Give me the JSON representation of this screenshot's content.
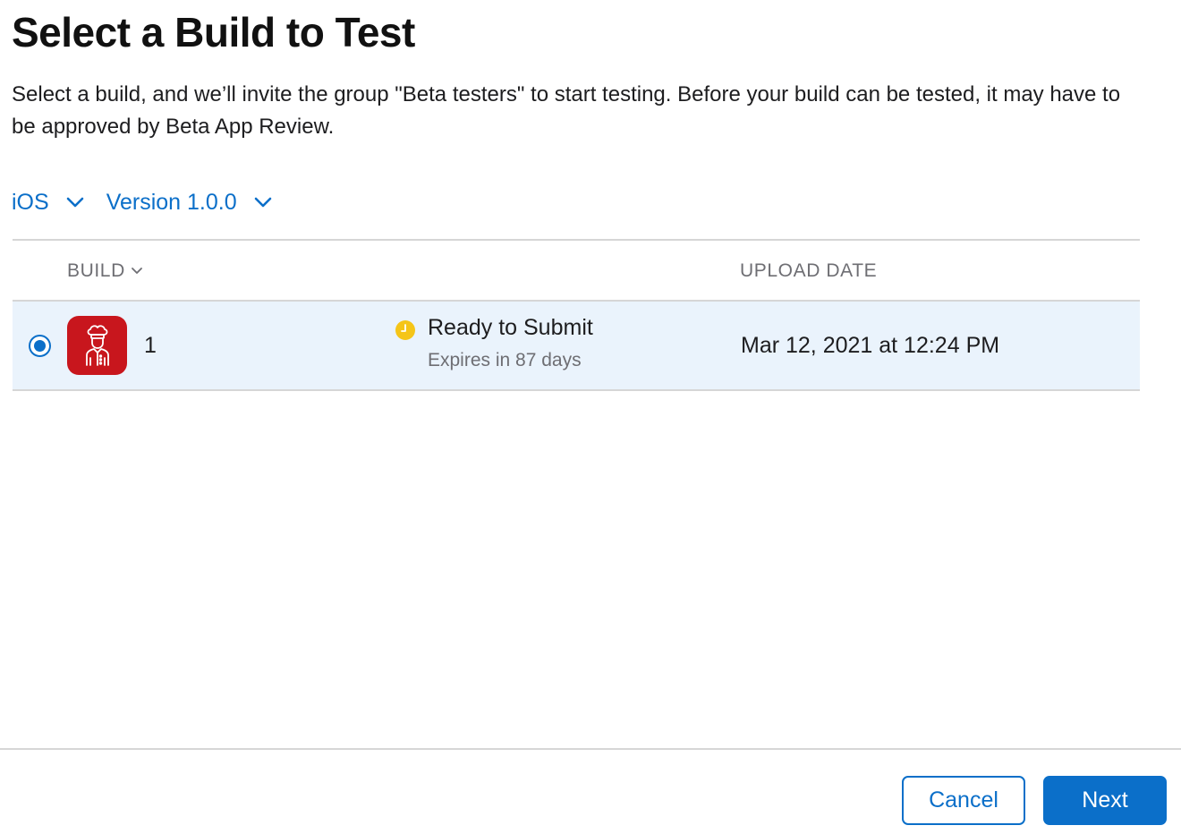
{
  "dialog": {
    "title": "Select a Build to Test",
    "description": "Select a build, and we’ll invite the group \"Beta testers\" to start testing. Before your build can be tested, it may have to be approved by Beta App Review."
  },
  "filters": {
    "platform": {
      "label": "iOS",
      "icon": "chevron-down-icon"
    },
    "version": {
      "label": "Version 1.0.0",
      "icon": "chevron-down-icon"
    }
  },
  "table": {
    "columns": {
      "build": "BUILD",
      "upload_date": "UPLOAD DATE"
    },
    "rows": [
      {
        "selected": true,
        "app_icon": "chef-icon",
        "build": "1",
        "status": "Ready to Submit",
        "status_icon": "clock-icon",
        "status_color": "#f5c518",
        "status_detail": "Expires in 87 days",
        "upload_date": "Mar 12, 2021 at 12:24 PM"
      }
    ]
  },
  "footer": {
    "cancel_label": "Cancel",
    "next_label": "Next"
  },
  "colors": {
    "accent": "#0b6fc9",
    "selected_row": "#eaf3fc",
    "app_icon_bg": "#c8161d"
  }
}
